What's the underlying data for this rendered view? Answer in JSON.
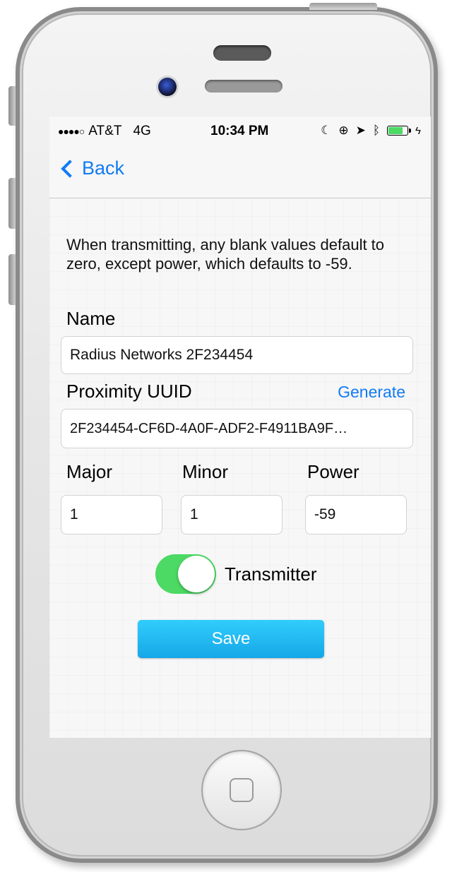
{
  "status_bar": {
    "signal": "●●●●○",
    "carrier": "AT&T",
    "network": "4G",
    "time": "10:34 PM",
    "icons": [
      "moon-icon",
      "orientation-lock-icon",
      "location-icon",
      "bluetooth-icon",
      "battery-icon",
      "charging-icon"
    ]
  },
  "nav": {
    "back_label": "Back"
  },
  "form": {
    "instructions": "When transmitting, any blank values default to zero, except power, which defaults to -59.",
    "name_label": "Name",
    "name_value": "Radius Networks 2F234454",
    "uuid_label": "Proximity UUID",
    "generate_label": "Generate",
    "uuid_value": "2F234454-CF6D-4A0F-ADF2-F4911BA9F…",
    "major_label": "Major",
    "major_value": "1",
    "minor_label": "Minor",
    "minor_value": "1",
    "power_label": "Power",
    "power_value": "-59",
    "transmitter_label": "Transmitter",
    "transmitter_on": true,
    "save_label": "Save"
  },
  "colors": {
    "accent": "#127bf5",
    "toggle_on": "#4cd964",
    "save_button": "#1fb6f0"
  }
}
